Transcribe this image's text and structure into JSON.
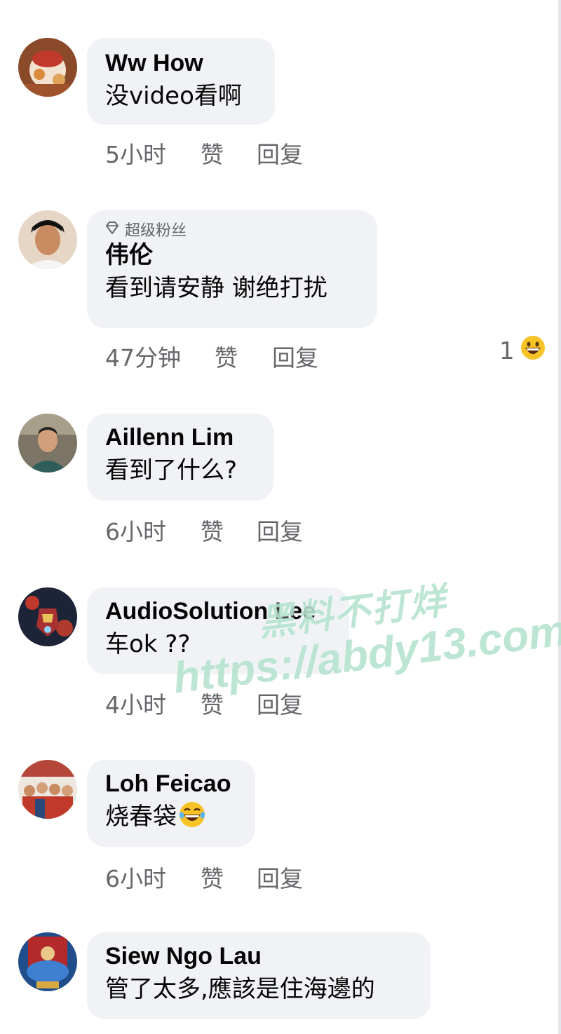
{
  "comments": [
    {
      "name": "Ww How",
      "text": "没video看啊",
      "time": "5小时",
      "like": "赞",
      "reply": "回复"
    },
    {
      "badge": "超级粉丝",
      "name": "伟伦",
      "text": "看到请安静 谢绝打扰",
      "time": "47分钟",
      "like": "赞",
      "reply": "回复",
      "reaction_count": "1",
      "reaction_icon": "grinning-emoji-icon"
    },
    {
      "name": "Aillenn Lim",
      "text": "看到了什么?",
      "time": "6小时",
      "like": "赞",
      "reply": "回复"
    },
    {
      "name": "AudioSolution Lee",
      "text": "车ok ??",
      "time": "4小时",
      "like": "赞",
      "reply": "回复"
    },
    {
      "name": "Loh Feicao",
      "text": "烧春袋",
      "text_emoji": "laughing-tears-emoji-icon",
      "time": "6小时",
      "like": "赞",
      "reply": "回复"
    },
    {
      "name": "Siew Ngo Lau",
      "text": "管了太多,應該是住海邊的"
    }
  ],
  "watermark": {
    "line1": "黑料不打烊",
    "line2": "https://abdy13.com"
  },
  "colors": {
    "bubble": "#f0f2f5",
    "meta_text": "#65676b",
    "watermark": "#b6e3d0"
  }
}
